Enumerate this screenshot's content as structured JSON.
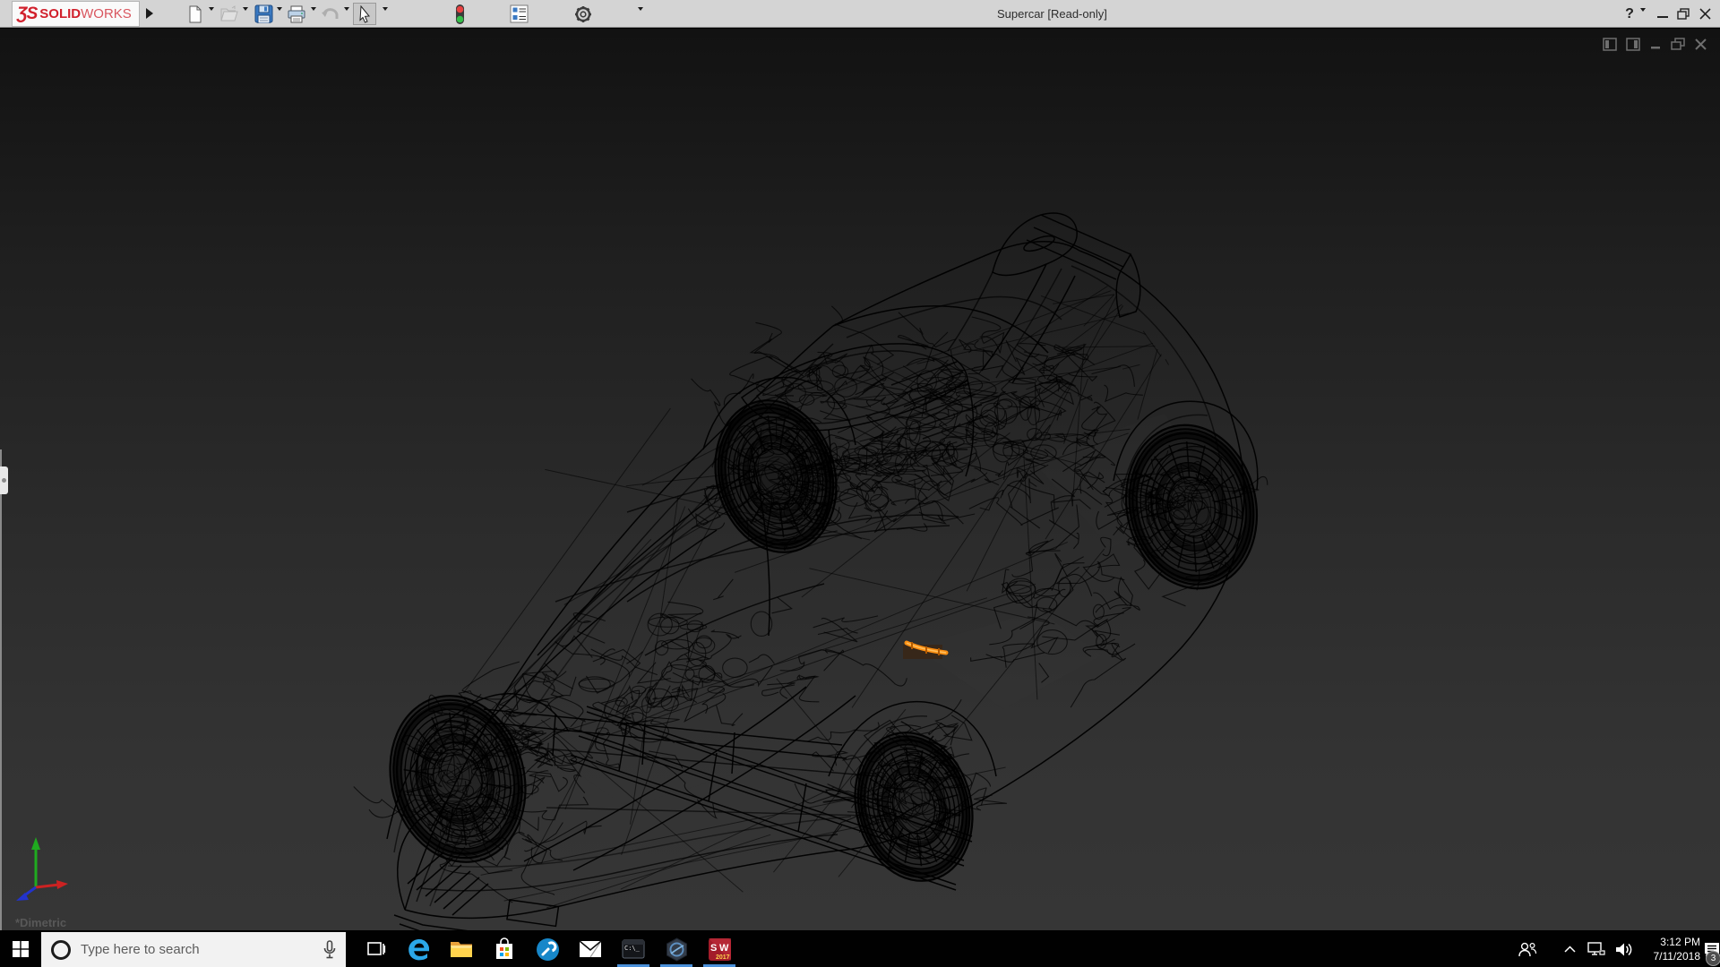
{
  "app": {
    "logo_ds": "ƷS",
    "logo_solid": "SOLID",
    "logo_works": "WORKS",
    "title": "Supercar [Read-only]",
    "help_label": "?"
  },
  "toolbar": {
    "icons": [
      "new-document",
      "open",
      "save",
      "print",
      "undo",
      "select-cursor",
      "rebuild-stoplight",
      "file-properties",
      "options-gear"
    ]
  },
  "window_buttons": [
    "help",
    "minimize",
    "restore",
    "close"
  ],
  "viewport": {
    "orientation_label": "*Dimetric",
    "doc_controls": [
      "pane-left",
      "pane-right",
      "minimize-document",
      "restore-document",
      "close-document"
    ],
    "highlight_color": "#ff9012",
    "background_top": "#121212",
    "background_bottom": "#363636",
    "wireframe_color": "#000000",
    "triad_axis_colors": {
      "x": "#cc2222",
      "y": "#1faa1f",
      "z": "#2233cc"
    }
  },
  "taskbar": {
    "search_placeholder": "Type here to search",
    "icons": [
      "start",
      "cortana-circle",
      "search-mic",
      "task-view",
      "edge",
      "file-explorer",
      "store",
      "help-wrench",
      "mail",
      "command-prompt",
      "edrawings",
      "solidworks-2017"
    ],
    "running_indicator_color": "#4a90d9"
  },
  "tray": {
    "icons": [
      "people",
      "hidden-icons-chevron",
      "network",
      "volume",
      "action-center"
    ],
    "time": "3:12 PM",
    "date": "7/11/2018",
    "badge_count": "3"
  }
}
